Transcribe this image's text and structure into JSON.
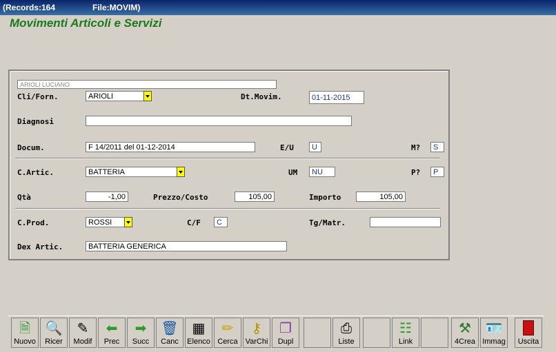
{
  "titlebar": {
    "records": "(Records:164",
    "file": "File:MOVIM)"
  },
  "heading": "Movimenti Articoli e Servizi",
  "form": {
    "name_field": "ARIOLI LUCIANO",
    "cli_forn_label": "Cli/Forn.",
    "cli_forn_value": "ARIOLI",
    "dt_movim_label": "Dt.Movim.",
    "dt_movim_value": "01-11-2015",
    "diagnosi_label": "Diagnosi",
    "diagnosi_value": "",
    "docum_label": "Docum.",
    "docum_value": "F 14/2011 del 01-12-2014",
    "eu_label": "E/U",
    "eu_value": "U",
    "m_label": "M?",
    "m_value": "S",
    "c_artic_label": "C.Artic.",
    "c_artic_value": "BATTERIA",
    "um_label": "UM",
    "um_value": "NU",
    "p_label": "P?",
    "p_value": "P",
    "qta_label": "Qtà",
    "qta_value": "-1,00",
    "prezzo_label": "Prezzo/Costo",
    "prezzo_value": "105,00",
    "importo_label": "Importo",
    "importo_value": "105,00",
    "c_prod_label": "C.Prod.",
    "c_prod_value": "ROSSI",
    "cf_label": "C/F",
    "cf_value": "C",
    "tg_label": "Tg/Matr.",
    "tg_value": "",
    "dex_label": "Dex Artic.",
    "dex_value": "BATTERIA GENERICA"
  },
  "toolbar": {
    "buttons": [
      {
        "label": "Nuovo",
        "icon": "new-doc-icon"
      },
      {
        "label": "Ricer",
        "icon": "magnifier-icon"
      },
      {
        "label": "Modif",
        "icon": "edit-icon"
      },
      {
        "label": "Prec",
        "icon": "arrow-left-icon"
      },
      {
        "label": "Succ",
        "icon": "arrow-right-icon"
      },
      {
        "label": "Canc",
        "icon": "trash-icon"
      },
      {
        "label": "Elenco",
        "icon": "table-icon"
      },
      {
        "label": "Cerca",
        "icon": "highlighter-icon"
      },
      {
        "label": "VarChi",
        "icon": "keys-icon"
      },
      {
        "label": "Dupl",
        "icon": "duplicate-icon"
      },
      {
        "label": "",
        "icon": ""
      },
      {
        "label": "Liste",
        "icon": "printer-icon"
      },
      {
        "label": "",
        "icon": ""
      },
      {
        "label": "Link",
        "icon": "tree-icon"
      },
      {
        "label": "",
        "icon": ""
      },
      {
        "label": "4Crea",
        "icon": "build-icon"
      },
      {
        "label": "Immag",
        "icon": "id-card-icon"
      },
      {
        "label": "Uscita",
        "icon": "exit-door-icon"
      }
    ]
  },
  "colors": {
    "title_bg": "#0a246a",
    "heading": "#1a7a1a",
    "dropdown": "#ffff00"
  }
}
